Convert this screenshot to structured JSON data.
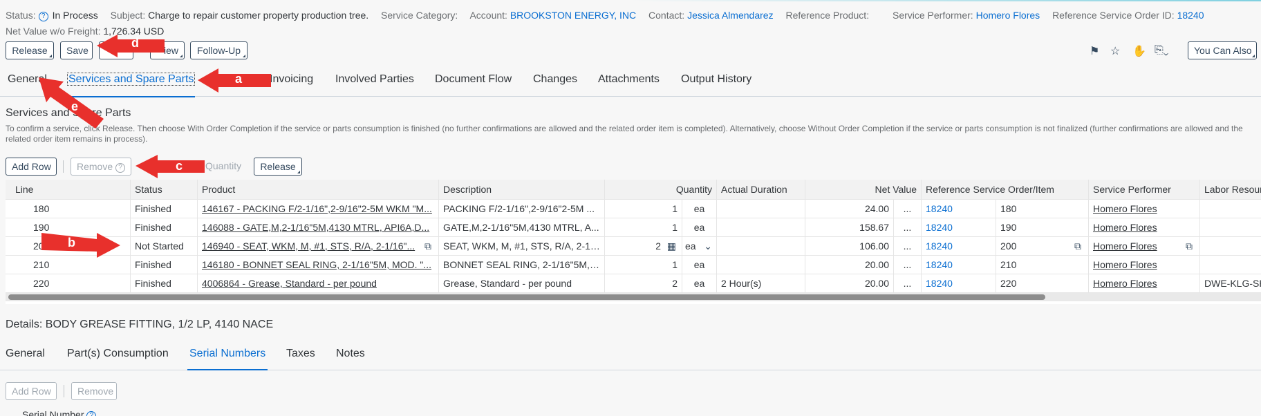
{
  "header": {
    "status_label": "Status:",
    "status_value": "In Process",
    "subject_label": "Subject:",
    "subject_value": "Charge to repair customer property production tree.",
    "service_category_label": "Service Category:",
    "account_label": "Account:",
    "account_value": "BROOKSTON ENERGY, INC",
    "contact_label": "Contact:",
    "contact_value": "Jessica Almendarez",
    "reference_product_label": "Reference Product:",
    "service_performer_label": "Service Performer:",
    "service_performer_value": "Homero Flores",
    "ref_order_label": "Reference Service Order ID:",
    "ref_order_value": "18240",
    "net_value_label": "Net Value w/o Freight:",
    "net_value": "1,726.34 USD"
  },
  "toolbar": {
    "release": "Release",
    "save": "Save",
    "hidden1": "",
    "view": "iew",
    "follow_up": "Follow-Up",
    "you_can_also": "You Can Also"
  },
  "tabs": [
    "General",
    "Services and Spare Parts",
    "Invoicing",
    "Involved Parties",
    "Document Flow",
    "Changes",
    "Attachments",
    "Output History"
  ],
  "section": {
    "title": "Services and Spare Parts",
    "description": "To confirm a service, click Release. Then choose With Order Completion if the service or parts consumption is finished (no further confirmations are allowed and the related order item is completed). Alternatively, choose Without Order Completion if the service or parts consumption is not finalized (further confirmations are allowed and the related order item remains in process)."
  },
  "table_toolbar": {
    "add_row": "Add Row",
    "remove": "Remove",
    "quantity": "Quantity",
    "release": "Release"
  },
  "columns": [
    "Line",
    "Status",
    "Product",
    "Description",
    "Quantity",
    "Actual Duration",
    "Net Value",
    "Reference Service Order/Item",
    "Service Performer",
    "Labor Resource"
  ],
  "rows": [
    {
      "line": "180",
      "status": "Finished",
      "product": "146167 - PACKING F/2-1/16\",2-9/16\"2-5M WKM \"M...",
      "description": "PACKING F/2-1/16\",2-9/16\"2-5M ...",
      "qty": "1",
      "unit": "ea",
      "duration": "",
      "net": "24.00",
      "order": "18240",
      "item": "180",
      "performer": "Homero Flores",
      "labor": ""
    },
    {
      "line": "190",
      "status": "Finished",
      "product": "146088 - GATE,M,2-1/16\"5M,4130 MTRL, API6A,D...",
      "description": "GATE,M,2-1/16\"5M,4130 MTRL, A...",
      "qty": "1",
      "unit": "ea",
      "duration": "",
      "net": "158.67",
      "order": "18240",
      "item": "190",
      "performer": "Homero Flores",
      "labor": ""
    },
    {
      "line": "200",
      "status": "Not Started",
      "product": "146940 - SEAT, WKM, M, #1, STS, R/A, 2-1/16\"...",
      "description": "SEAT, WKM, M, #1, STS, R/A, 2-1/...",
      "qty": "2",
      "unit": "ea",
      "duration": "",
      "net": "106.00",
      "order": "18240",
      "item": "200",
      "performer": "Homero Flores",
      "labor": ""
    },
    {
      "line": "210",
      "status": "Finished",
      "product": "146180 - BONNET SEAL RING, 2-1/16\"5M, MOD. \"...",
      "description": "BONNET SEAL RING, 2-1/16\"5M, ...",
      "qty": "1",
      "unit": "ea",
      "duration": "",
      "net": "20.00",
      "order": "18240",
      "item": "210",
      "performer": "Homero Flores",
      "labor": ""
    },
    {
      "line": "220",
      "status": "Finished",
      "product": "4006864 - Grease, Standard - per pound",
      "description": "Grease, Standard - per pound",
      "qty": "2",
      "unit": "ea",
      "duration": "2 Hour(s)",
      "net": "20.00",
      "order": "18240",
      "item": "220",
      "performer": "Homero Flores",
      "labor": "DWE-KLG-SHO"
    }
  ],
  "ellipsis": "...",
  "details": {
    "title": "Details: BODY GREASE FITTING, 1/2 LP, 4140 NACE",
    "tabs": [
      "General",
      "Part(s) Consumption",
      "Serial Numbers",
      "Taxes",
      "Notes"
    ],
    "add_row": "Add Row",
    "remove": "Remove",
    "serial_label": "Serial Number"
  },
  "annotations": [
    "a",
    "b",
    "c",
    "d",
    "e"
  ],
  "colors": {
    "arrow": "#e8302c",
    "link": "#0a6ed1",
    "accent": "#354a5f"
  }
}
